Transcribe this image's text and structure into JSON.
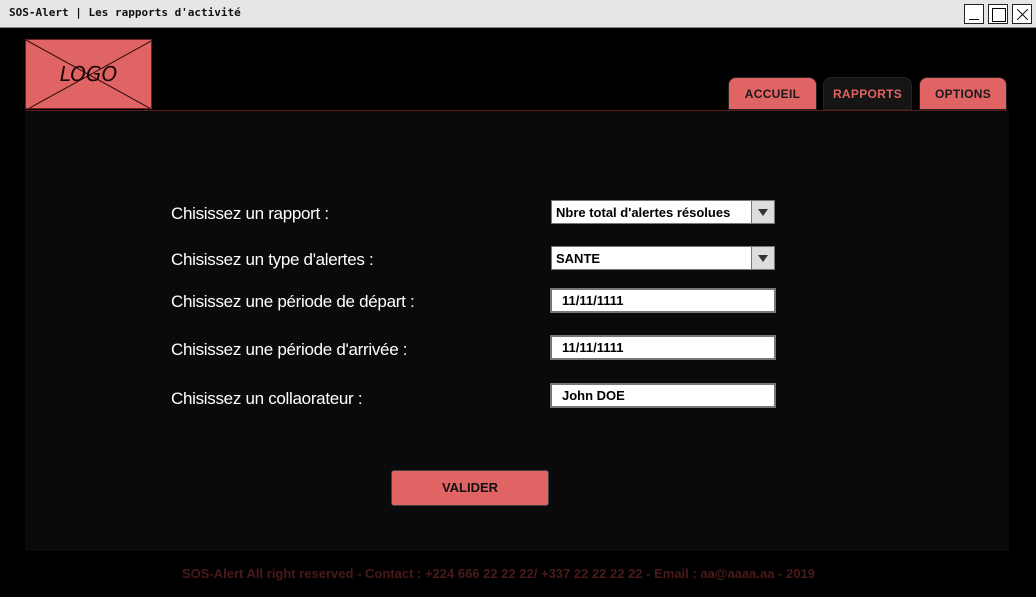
{
  "window": {
    "title": "SOS-Alert | Les rapports d'activité"
  },
  "logo": {
    "text": "LOGO"
  },
  "nav": {
    "tabs": [
      {
        "label": "ACCUEIL"
      },
      {
        "label": "RAPPORTS",
        "active": true
      },
      {
        "label": "OPTIONS"
      }
    ]
  },
  "form": {
    "report_label": "Chisissez un rapport :",
    "report_value": "Nbre total d'alertes résolues",
    "alert_type_label": "Chisissez un type d'alertes :",
    "alert_type_value": "SANTE",
    "start_label": "Chisissez une période de départ :",
    "start_value": "11/11/1111",
    "end_label": "Chisissez une période d'arrivée :",
    "end_value": "11/11/1111",
    "collaborator_label": "Chisissez un collaorateur :",
    "collaborator_value": "John DOE",
    "submit_label": "VALIDER"
  },
  "footer": {
    "text": "SOS-Alert All right reserved - Contact : +224 666 22 22 22/ +337 22 22 22 22 - Email : aa@aaaa.aa - 2019"
  },
  "colors": {
    "accent": "#e06464",
    "background": "#000000",
    "footer_text": "#4a1a1a"
  }
}
